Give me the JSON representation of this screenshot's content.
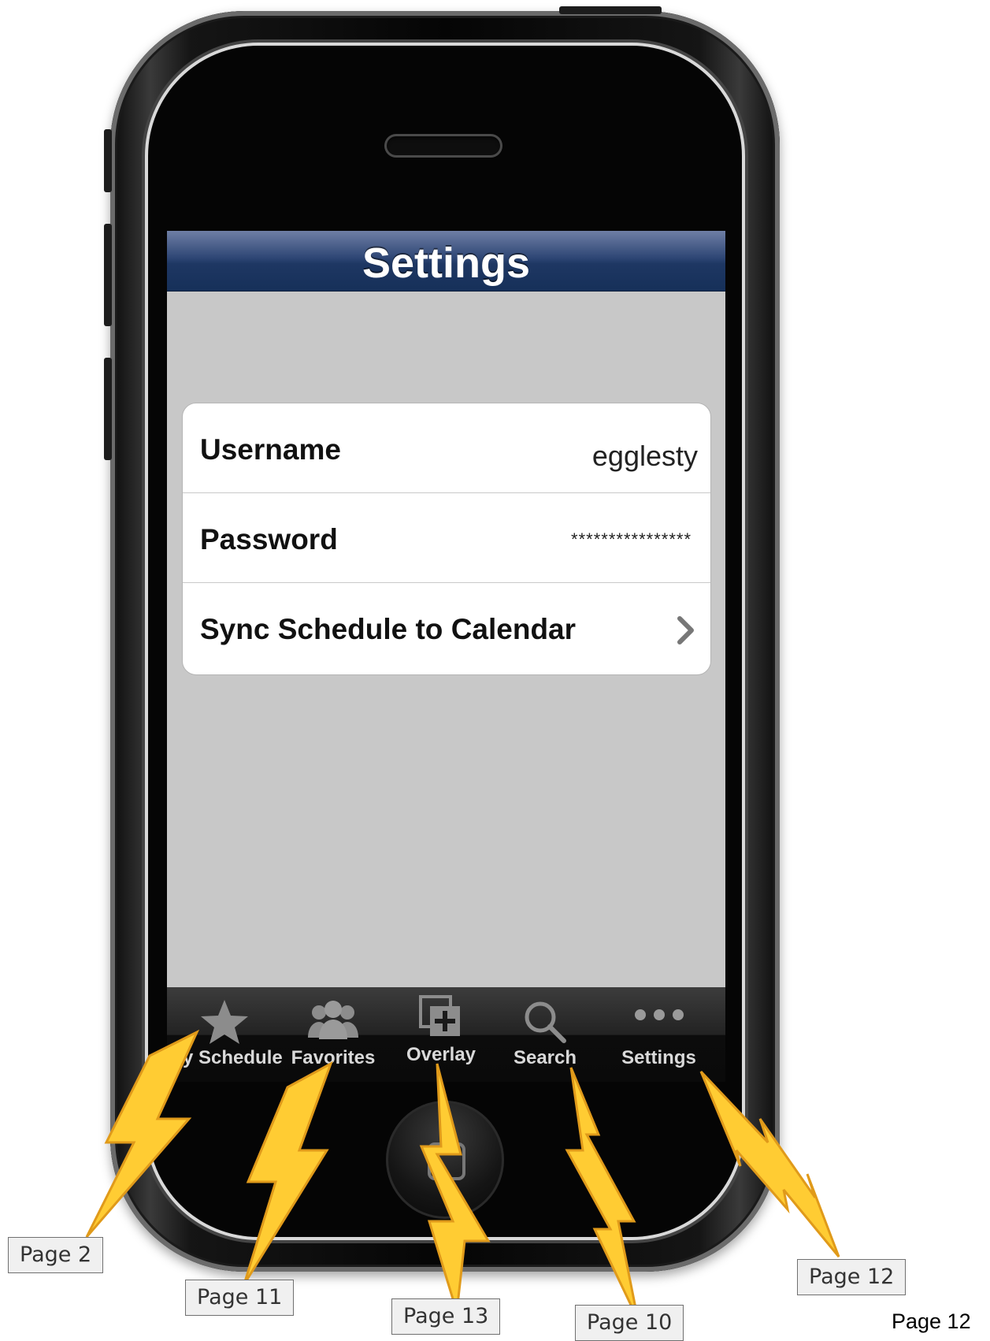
{
  "screen": {
    "title": "Settings",
    "rows": [
      {
        "label": "Username",
        "value": "egglesty"
      },
      {
        "label": "Password",
        "value": "****************"
      },
      {
        "label": "Sync Schedule to Calendar",
        "accessory": "chevron-right-icon"
      }
    ],
    "tabs": [
      {
        "label": "My Schedule",
        "icon": "star-icon"
      },
      {
        "label": "Favorites",
        "icon": "people-icon"
      },
      {
        "label": "Overlay",
        "icon": "overlay-add-icon"
      },
      {
        "label": "Search",
        "icon": "search-icon"
      },
      {
        "label": "Settings",
        "icon": "more-icon"
      }
    ]
  },
  "annotations": [
    {
      "label": "Page 2"
    },
    {
      "label": "Page 11"
    },
    {
      "label": "Page 13"
    },
    {
      "label": "Page 10"
    },
    {
      "label": "Page 12"
    }
  ],
  "footer": {
    "page": "Page 12"
  },
  "colors": {
    "navbar": "#1e3763",
    "background": "#c8c8c8",
    "bolt": "#ffcc33",
    "bolt_outline": "#e09a1a"
  }
}
